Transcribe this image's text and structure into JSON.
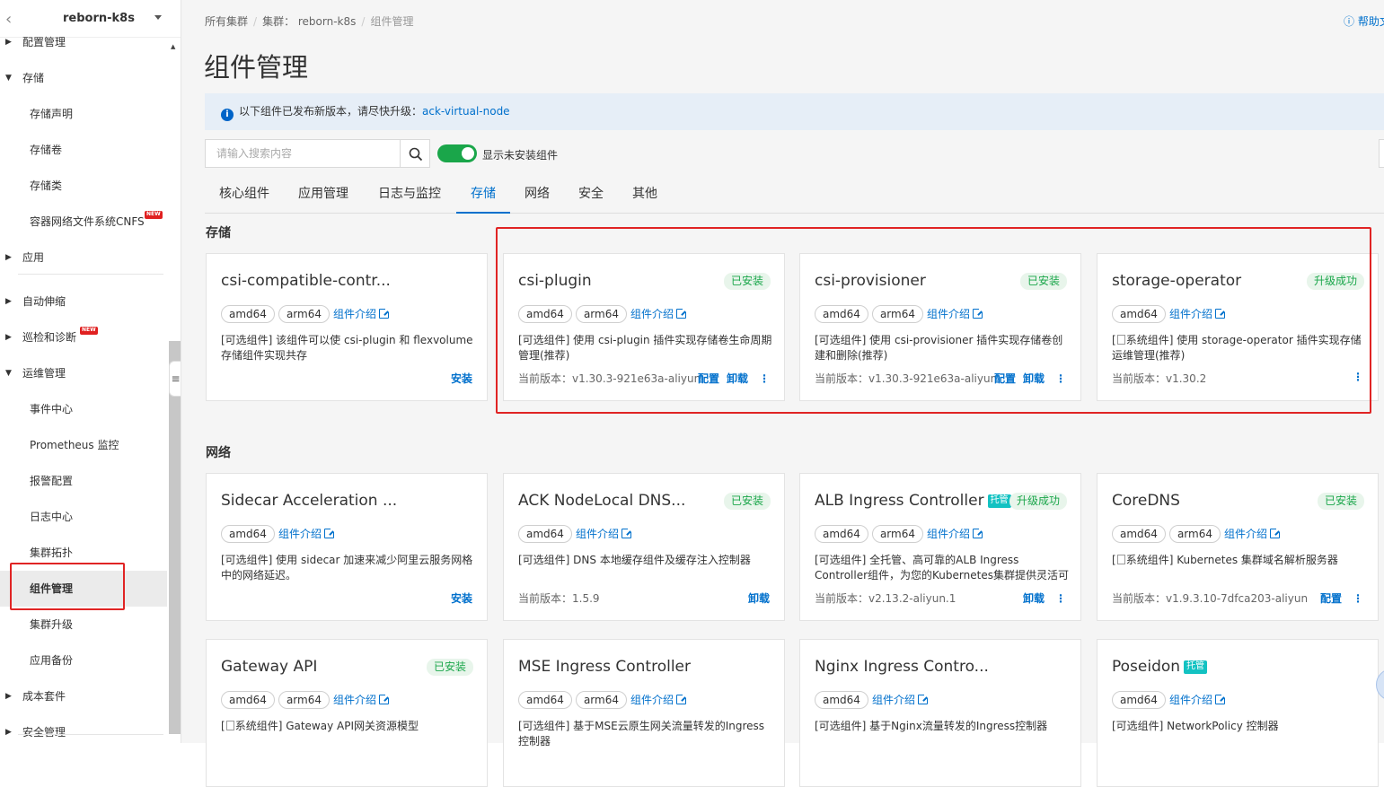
{
  "sidebar": {
    "cluster_name": "reborn-k8s",
    "items": [
      {
        "label": "配置管理",
        "level": "top",
        "expanded": false
      },
      {
        "label": "存储",
        "level": "top",
        "expanded": true
      },
      {
        "label": "存储声明",
        "level": "sub"
      },
      {
        "label": "存储卷",
        "level": "sub"
      },
      {
        "label": "存储类",
        "level": "sub"
      },
      {
        "label": "容器网络文件系统CNFS",
        "level": "sub",
        "badge": "NEW"
      },
      {
        "label": "应用",
        "level": "top",
        "expanded": false
      },
      {
        "label": "自动伸缩",
        "level": "top",
        "expanded": false
      },
      {
        "label": "巡检和诊断",
        "level": "top",
        "expanded": false,
        "badge": "NEW"
      },
      {
        "label": "运维管理",
        "level": "top",
        "expanded": true
      },
      {
        "label": "事件中心",
        "level": "sub"
      },
      {
        "label": "Prometheus 监控",
        "level": "sub"
      },
      {
        "label": "报警配置",
        "level": "sub"
      },
      {
        "label": "日志中心",
        "level": "sub"
      },
      {
        "label": "集群拓扑",
        "level": "sub"
      },
      {
        "label": "组件管理",
        "level": "sub",
        "active": true
      },
      {
        "label": "集群升级",
        "level": "sub"
      },
      {
        "label": "应用备份",
        "level": "sub"
      },
      {
        "label": "成本套件",
        "level": "top",
        "expanded": false
      },
      {
        "label": "安全管理",
        "level": "top",
        "expanded": false
      }
    ]
  },
  "breadcrumb": [
    "所有集群",
    "集群： reborn-k8s",
    "组件管理"
  ],
  "help_label": "帮助文",
  "page_title": "组件管理",
  "notice": {
    "text": "以下组件已发布新版本，请尽快升级：",
    "link": "ack-virtual-node"
  },
  "search": {
    "placeholder": "请输入搜索内容",
    "value": ""
  },
  "toggle": {
    "label": "显示未安装组件",
    "on": true
  },
  "tabs": [
    {
      "label": "核心组件"
    },
    {
      "label": "应用管理"
    },
    {
      "label": "日志与监控"
    },
    {
      "label": "存储",
      "active": true
    },
    {
      "label": "网络"
    },
    {
      "label": "安全"
    },
    {
      "label": "其他"
    }
  ],
  "sections": [
    {
      "title": "存储",
      "cards": [
        {
          "name": "csi-compatible-contr...",
          "status": "",
          "tags": [
            "amd64",
            "arm64"
          ],
          "intro": "组件介绍",
          "desc": "[可选组件] 该组件可以使 csi-plugin 和 flexvolume 存储组件实现共存",
          "version": "",
          "actions": [
            "安装"
          ],
          "more": false
        },
        {
          "name": "csi-plugin",
          "status": "已安装",
          "tags": [
            "amd64",
            "arm64"
          ],
          "intro": "组件介绍",
          "desc": "[可选组件] 使用 csi-plugin 插件实现存储卷生命周期管理(推荐)",
          "version": "当前版本：v1.30.3-921e63a-aliyun",
          "actions": [
            "配置",
            "卸载"
          ],
          "more": true
        },
        {
          "name": "csi-provisioner",
          "status": "已安装",
          "tags": [
            "amd64",
            "arm64"
          ],
          "intro": "组件介绍",
          "desc": "[可选组件] 使用 csi-provisioner 插件实现存储卷创建和删除(推荐)",
          "version": "当前版本：v1.30.3-921e63a-aliyun",
          "actions": [
            "配置",
            "卸载"
          ],
          "more": true
        },
        {
          "name": "storage-operator",
          "status": "升级成功",
          "tags": [
            "amd64"
          ],
          "intro": "组件介绍",
          "desc_prefix": "[",
          "desc_sys": "系统组件]",
          "desc": " 使用 storage-operator 插件实现存储运维管理(推荐)",
          "version": "当前版本：v1.30.2",
          "actions": [],
          "more": true
        }
      ]
    },
    {
      "title": "网络",
      "cards": [
        {
          "name": "Sidecar Acceleration ...",
          "status": "",
          "tags": [
            "amd64"
          ],
          "intro": "组件介绍",
          "desc": "[可选组件] 使用 sidecar 加速来减少阿里云服务网格中的网络延迟。",
          "version": "",
          "actions": [
            "安装"
          ],
          "more": false
        },
        {
          "name": "ACK NodeLocal DNS...",
          "status": "已安装",
          "tags": [
            "amd64"
          ],
          "intro": "组件介绍",
          "desc": "[可选组件] DNS 本地缓存组件及缓存注入控制器",
          "version": "当前版本：1.5.9",
          "actions": [
            "卸载"
          ],
          "more": false
        },
        {
          "name": "ALB Ingress Controller",
          "badge": "托管",
          "status": "升级成功",
          "tags": [
            "amd64",
            "arm64"
          ],
          "intro": "组件介绍",
          "desc": "[可选组件] 全托管、高可靠的ALB Ingress Controller组件，为您的Kubernetes集群提供灵活可靠的路由...",
          "version": "当前版本：v2.13.2-aliyun.1",
          "actions": [
            "卸载"
          ],
          "more": true
        },
        {
          "name": "CoreDNS",
          "status": "已安装",
          "tags": [
            "amd64",
            "arm64"
          ],
          "intro": "组件介绍",
          "desc_prefix": "[",
          "desc_sys": "系统组件]",
          "desc": " Kubernetes 集群域名解析服务器",
          "version": "当前版本：v1.9.3.10-7dfca203-aliyun",
          "actions": [
            "配置"
          ],
          "more": true
        }
      ]
    },
    {
      "title": "",
      "cards": [
        {
          "name": "Gateway API",
          "status": "已安装",
          "tags": [
            "amd64",
            "arm64"
          ],
          "intro": "组件介绍",
          "desc_prefix": "[",
          "desc_sys": "系统组件]",
          "desc": " Gateway API网关资源模型",
          "version": "",
          "actions": [],
          "more": false
        },
        {
          "name": "MSE Ingress Controller",
          "status": "",
          "tags": [
            "amd64",
            "arm64"
          ],
          "intro": "组件介绍",
          "desc": "[可选组件] 基于MSE云原生网关流量转发的Ingress控制器",
          "version": "",
          "actions": [],
          "more": false
        },
        {
          "name": "Nginx Ingress Contro...",
          "status": "",
          "tags": [
            "amd64"
          ],
          "intro": "组件介绍",
          "desc": "[可选组件] 基于Nginx流量转发的Ingress控制器",
          "version": "",
          "actions": [],
          "more": false
        },
        {
          "name": "Poseidon",
          "badge": "托管",
          "status": "",
          "tags": [
            "amd64"
          ],
          "intro": "组件介绍",
          "desc": "[可选组件] NetworkPolicy 控制器",
          "version": "",
          "actions": [],
          "more": false
        }
      ]
    }
  ],
  "colors": {
    "accent": "#0070cc",
    "success": "#1aa64a",
    "highlight_box": "#e02424",
    "managed_badge": "#13c2c2"
  }
}
